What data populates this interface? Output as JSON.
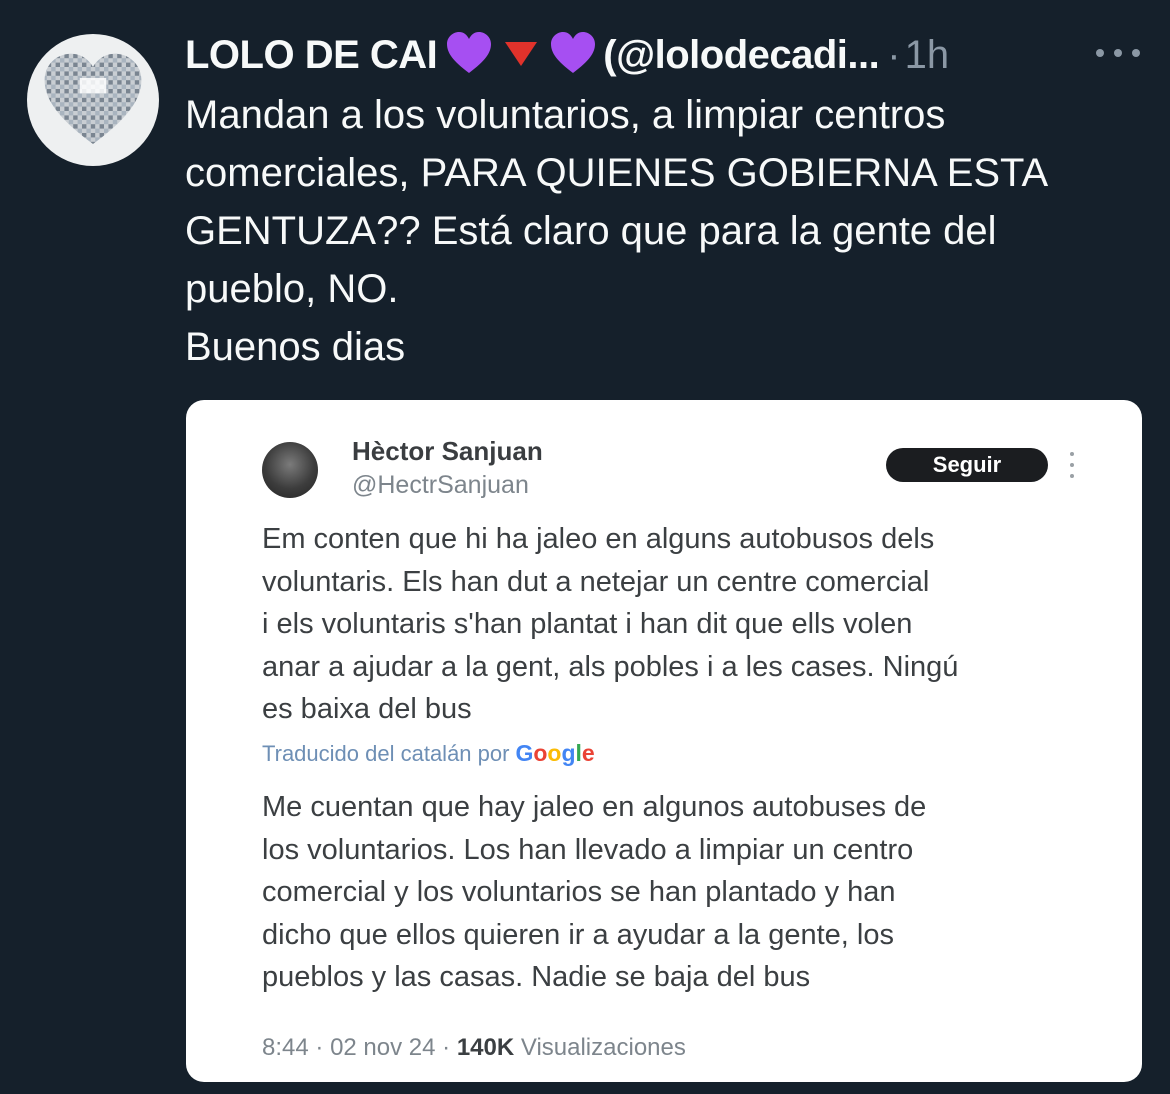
{
  "tweet": {
    "display_name": "LOLO DE CAI",
    "handle": "(@lolodecadi...",
    "separator": "·",
    "time": "1h",
    "text_lines": [
      "Mandan a los voluntarios, a limpiar centros",
      "comerciales, PARA QUIENES GOBIERNA ESTA",
      "GENTUZA?? Está claro que para la gente del",
      "pueblo, NO.",
      "Buenos dias"
    ],
    "icons": [
      "purple-heart-icon",
      "red-triangle-icon",
      "purple-heart-icon",
      "more-icon"
    ],
    "colors": {
      "background": "#15202b",
      "text": "#f7f9f9",
      "muted": "#8b98a5",
      "heart": "#a64ff2",
      "triangle": "#e0322b"
    }
  },
  "embedded": {
    "name": "Hèctor Sanjuan",
    "handle": "@HectrSanjuan",
    "follow_label": "Seguir",
    "original_lines": [
      "Em conten que hi ha jaleo en alguns autobusos dels",
      "voluntaris. Els han dut a netejar un centre comercial",
      "i els voluntaris s'han plantat i han dit que ells volen",
      "anar a ajudar a la gent, als pobles i a les cases. Ningú",
      "es baixa del bus"
    ],
    "translated_by": "Traducido del catalán por",
    "google": [
      "G",
      "o",
      "o",
      "g",
      "l",
      "e"
    ],
    "translation_lines": [
      "Me cuentan que hay jaleo en algunos autobuses de",
      "los voluntarios. Los han llevado a limpiar un centro",
      "comercial y los voluntarios se han plantado y han",
      "dicho que ellos quieren ir a ayudar a la gente, los",
      "pueblos y las casas. Nadie se baja del bus"
    ],
    "footer": {
      "time": "8:44",
      "sep1": "·",
      "date": "02 nov 24",
      "sep2": "·",
      "views": "140K",
      "views_label": "Visualizaciones"
    }
  }
}
